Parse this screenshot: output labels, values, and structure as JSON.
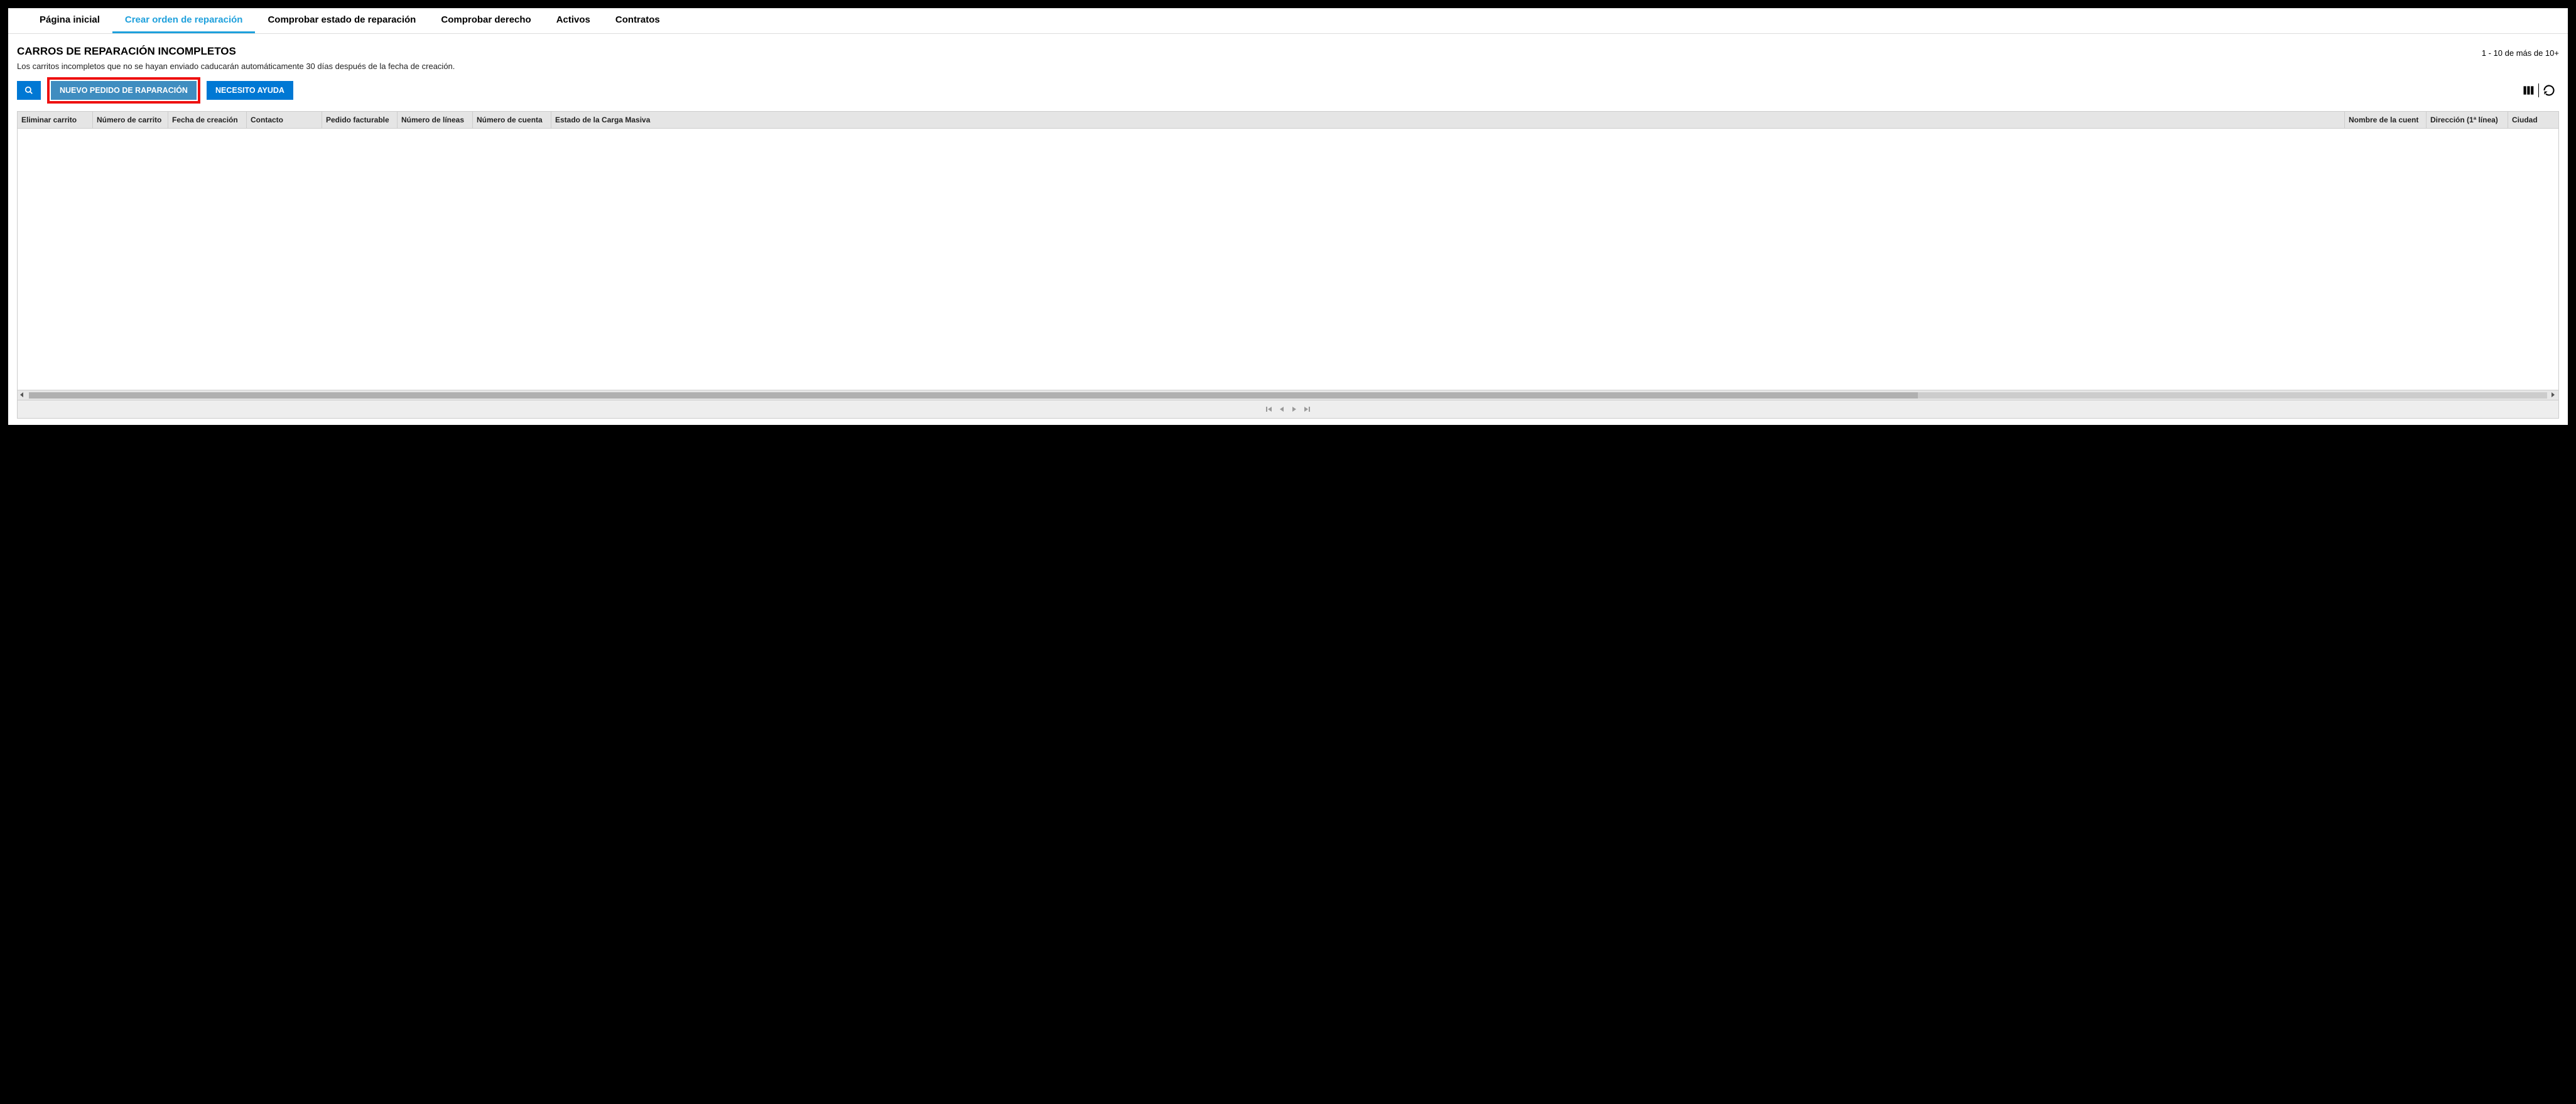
{
  "tabs": {
    "home": "Página inicial",
    "create": "Crear orden de reparación",
    "check_status": "Comprobar estado de reparación",
    "check_right": "Comprobar derecho",
    "assets": "Activos",
    "contracts": "Contratos"
  },
  "page": {
    "title": "CARROS DE REPARACIÓN INCOMPLETOS",
    "subtitle": "Los carritos incompletos que no se hayan enviado caducarán automáticamente 30 días después de la fecha de creación.",
    "range": "1 - 10 de más de 10+"
  },
  "buttons": {
    "new_repair": "NUEVO PEDIDO DE RAPARACIÓN",
    "need_help": "NECESITO AYUDA"
  },
  "columns": {
    "delete_cart": "Eliminar carrito",
    "cart_number": "Número de carrito",
    "created": "Fecha de creación",
    "contact": "Contacto",
    "billable": "Pedido facturable",
    "lines": "Número de líneas",
    "account_number": "Número de cuenta",
    "bulk_status": "Estado de la Carga Masiva",
    "account_name": "Nombre de la cuent",
    "address1": "Dirección (1ª línea)",
    "city": "Ciudad"
  }
}
